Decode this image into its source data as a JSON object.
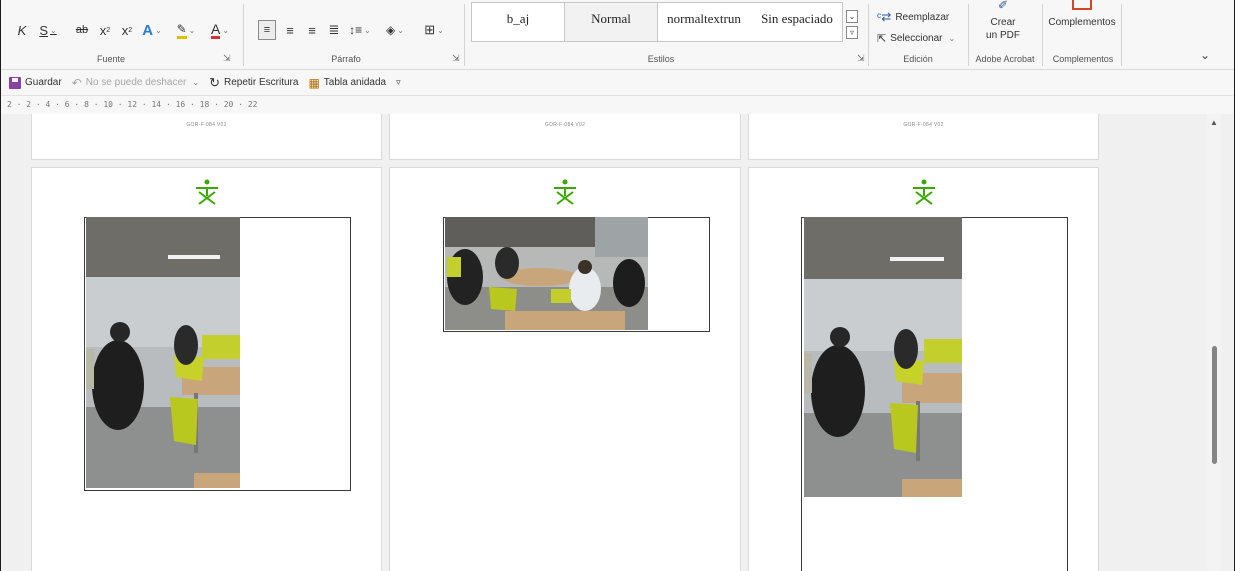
{
  "ribbon": {
    "font_group": {
      "label": "Fuente",
      "italic": "K",
      "underline": "S",
      "strikethrough": "ab",
      "subscript": "x",
      "superscript": "x"
    },
    "paragraph_group": {
      "label": "Párrafo"
    },
    "styles_group": {
      "label": "Estilos",
      "items": [
        "b_aj",
        "Normal",
        "normaltextrun",
        "Sin espaciado"
      ],
      "selected": "Normal"
    },
    "editing_group": {
      "label": "Edición",
      "replace": "Reemplazar",
      "select": "Seleccionar"
    },
    "acrobat_group": {
      "label": "Adobe Acrobat",
      "create_pdf_line1": "Crear",
      "create_pdf_line2": "un PDF"
    },
    "addins_group": {
      "label": "Complementos",
      "button": "Complementos"
    }
  },
  "qat": {
    "save": "Guardar",
    "undo": "No se puede deshacer",
    "redo": "Repetir Escritura",
    "nested_table": "Tabla anidada"
  },
  "ruler": {
    "text": "2 · 2 · 4 · 6 · 8 · 10 · 12 · 14 · 16 · 18 · 20 · 22"
  },
  "document": {
    "footer_code": "GOR-F-084 V02"
  },
  "colors": {
    "accent_blue": "#2b579a",
    "logo_green": "#39a900",
    "font_color_red": "#d13438",
    "highlight_yellow": "#e0c000"
  }
}
